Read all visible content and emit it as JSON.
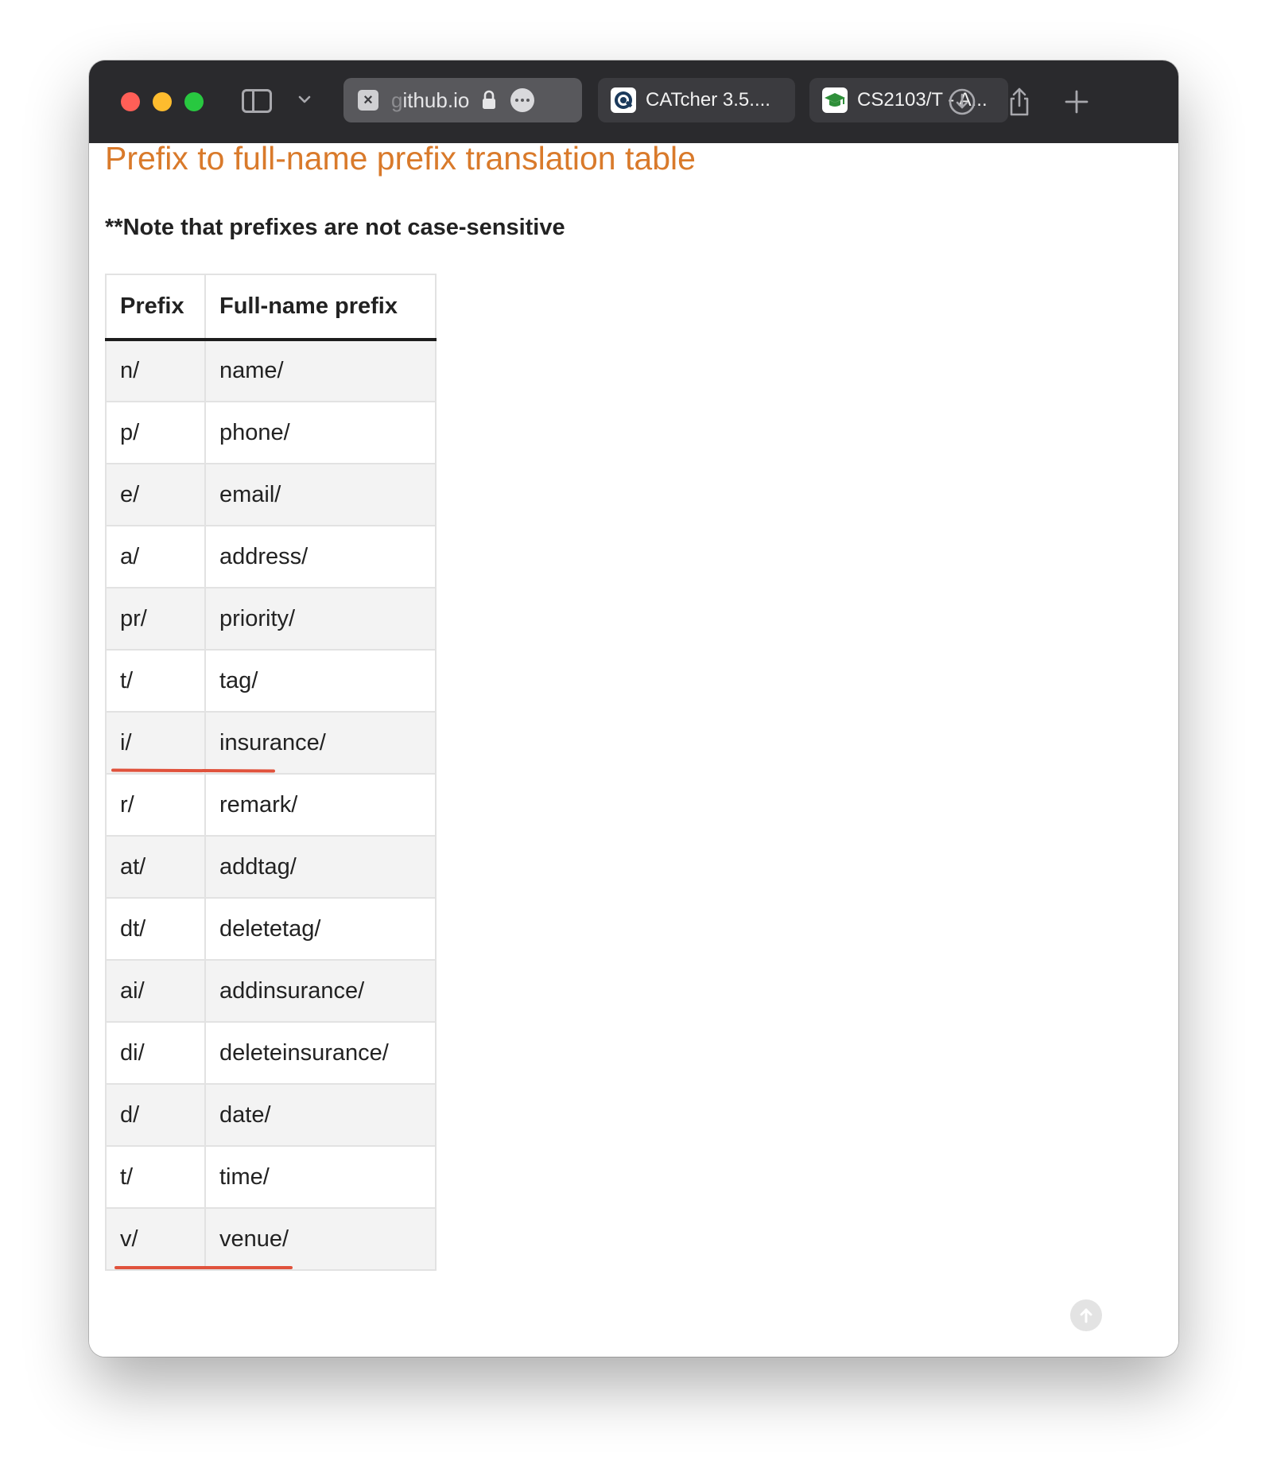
{
  "browser": {
    "tabs": [
      {
        "url_hidden": "g",
        "url_visible": "ithub.io",
        "active": true
      },
      {
        "title": "CATcher 3.5...."
      },
      {
        "title": "CS2103/T - A..."
      }
    ],
    "close_glyph": "×"
  },
  "page": {
    "heading": "Prefix to full-name prefix translation table",
    "note": "**Note that prefixes are not case-sensitive",
    "accent_color": "#d97a2b",
    "table": {
      "headers": [
        "Prefix",
        "Full-name prefix"
      ],
      "rows": [
        [
          "n/",
          "name/"
        ],
        [
          "p/",
          "phone/"
        ],
        [
          "e/",
          "email/"
        ],
        [
          "a/",
          "address/"
        ],
        [
          "pr/",
          "priority/"
        ],
        [
          "t/",
          "tag/"
        ],
        [
          "i/",
          "insurance/"
        ],
        [
          "r/",
          "remark/"
        ],
        [
          "at/",
          "addtag/"
        ],
        [
          "dt/",
          "deletetag/"
        ],
        [
          "ai/",
          "addinsurance/"
        ],
        [
          "di/",
          "deleteinsurance/"
        ],
        [
          "d/",
          "date/"
        ],
        [
          "t/",
          "time/"
        ],
        [
          "v/",
          "venue/"
        ]
      ]
    },
    "annotation_color": "#e0523c"
  }
}
